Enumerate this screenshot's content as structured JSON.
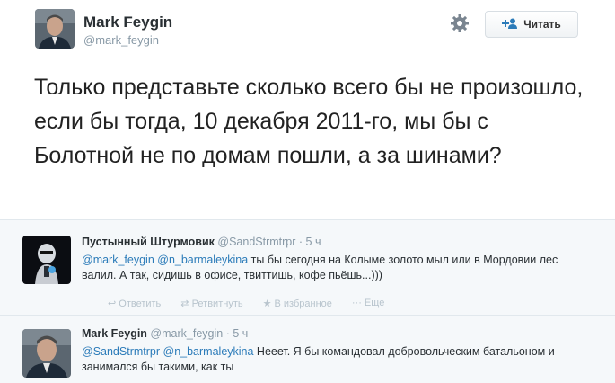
{
  "main": {
    "author_name": "Mark Feygin",
    "author_handle": "@mark_feygin",
    "follow_label": "Читать",
    "tweet_text": "Только представьте сколько всего бы не произошло, если бы тогда, 10 декабря 2011-го, мы бы с Болотной не по домам пошли, а за шинами?"
  },
  "reply1": {
    "name": "Пустынный Штурмовик",
    "handle": "@SandStrmtrpr",
    "time": "· 5 ч",
    "mention1": "@mark_feygin",
    "mention2": "@n_barmaleykina",
    "text": " ты бы сегодня на Колыме золото мыл или в Мордовии лес валил. А так, сидишь в офисе, твиттишь, кофе пьёшь...)))",
    "actions": {
      "reply": "↩ Ответить",
      "retweet": "⇄ Ретвитнуть",
      "favorite": "★ В избранное",
      "more": "··· Еще"
    }
  },
  "reply2": {
    "name": "Mark Feygin",
    "handle": "@mark_feygin",
    "time": "· 5 ч",
    "mention1": "@SandStrmtrpr",
    "mention2": "@n_barmaleykina",
    "text": " Нееет. Я бы командовал добровольческим батальоном и занимался бы такими, как ты"
  },
  "colors": {
    "link": "#2b7bb9",
    "muted": "#8899a6",
    "reply_bg": "#f5f8fa"
  }
}
